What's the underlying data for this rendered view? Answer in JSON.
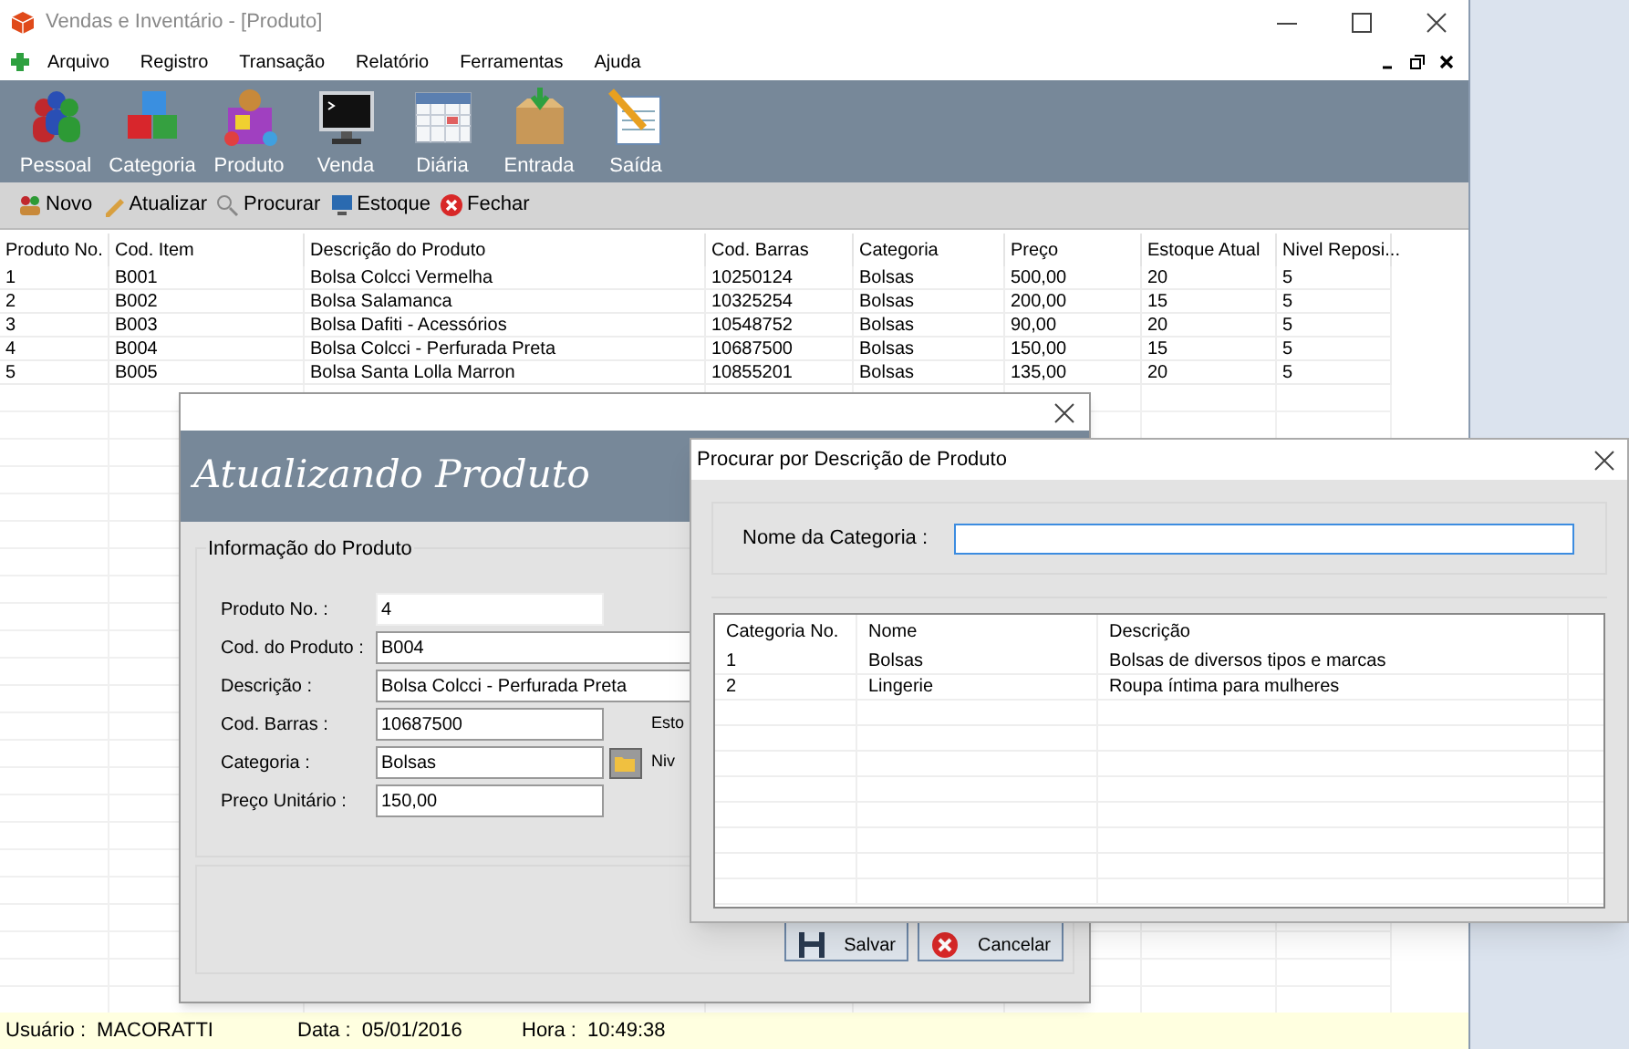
{
  "window": {
    "title": "Vendas e Inventário - [Produto]"
  },
  "menu": [
    "Arquivo",
    "Registro",
    "Transação",
    "Relatório",
    "Ferramentas",
    "Ajuda"
  ],
  "toolbar": [
    {
      "label": "Pessoal",
      "kind": "people"
    },
    {
      "label": "Categoria",
      "kind": "cubes"
    },
    {
      "label": "Produto",
      "kind": "toy"
    },
    {
      "label": "Venda",
      "kind": "monitor"
    },
    {
      "label": "Diária",
      "kind": "calendar"
    },
    {
      "label": "Entrada",
      "kind": "box"
    },
    {
      "label": "Saída",
      "kind": "notepad"
    }
  ],
  "actions": [
    {
      "label": "Novo",
      "kind": "new"
    },
    {
      "label": "Atualizar",
      "kind": "update"
    },
    {
      "label": "Procurar",
      "kind": "search"
    },
    {
      "label": "Estoque",
      "kind": "stock"
    },
    {
      "label": "Fechar",
      "kind": "close"
    }
  ],
  "table": {
    "columns": [
      "Produto No.",
      "Cod. Item",
      "Descrição do Produto",
      "Cod. Barras",
      "Categoria",
      "Preço",
      "Estoque Atual",
      "Nivel Reposi..."
    ],
    "rows": [
      [
        "1",
        "B001",
        "Bolsa Colcci Vermelha",
        "10250124",
        "Bolsas",
        "500,00",
        "20",
        "5"
      ],
      [
        "2",
        "B002",
        "Bolsa Salamanca",
        "10325254",
        "Bolsas",
        "200,00",
        "15",
        "5"
      ],
      [
        "3",
        "B003",
        "Bolsa Dafiti - Acessórios",
        "10548752",
        "Bolsas",
        "90,00",
        "20",
        "5"
      ],
      [
        "4",
        "B004",
        "Bolsa Colcci - Perfurada Preta",
        "10687500",
        "Bolsas",
        "150,00",
        "15",
        "5"
      ],
      [
        "5",
        "B005",
        "Bolsa Santa Lolla Marron",
        "10855201",
        "Bolsas",
        "135,00",
        "20",
        "5"
      ]
    ]
  },
  "edit_dialog": {
    "header": "Atualizando Produto",
    "group": "Informação do Produto",
    "fields": [
      {
        "label": "Produto No. :",
        "value": "4",
        "kind": "short"
      },
      {
        "label": "Cod. do Produto :",
        "value": "B004",
        "kind": "long"
      },
      {
        "label": "Descrição :",
        "value": "Bolsa Colcci - Perfurada Preta",
        "kind": "long"
      },
      {
        "label": "Cod. Barras :",
        "value": "10687500",
        "kind": "medium",
        "side_label": "Esto"
      },
      {
        "label": "Categoria :",
        "value": "Bolsas",
        "kind": "lookup",
        "side_label": "Niv"
      },
      {
        "label": "Preço Unitário :",
        "value": "150,00",
        "kind": "medium"
      }
    ],
    "buttons": [
      {
        "label": "Salvar",
        "kind": "save"
      },
      {
        "label": "Cancelar",
        "kind": "cancel"
      }
    ]
  },
  "search_dialog": {
    "title": "Procurar por Descrição de Produto",
    "field_label": "Nome da Categoria :",
    "table": {
      "columns": [
        "Categoria No.",
        "Nome",
        "Descrição"
      ],
      "rows": [
        [
          "1",
          "Bolsas",
          "Bolsas de diversos tipos e marcas"
        ],
        [
          "2",
          "Lingerie",
          "Roupa íntima para mulheres"
        ]
      ]
    }
  },
  "status_bar": [
    {
      "label": "Usuário :",
      "value": "MACORATTI"
    },
    {
      "label": "Data :",
      "value": "05/01/2016"
    },
    {
      "label": "Hora  :",
      "value": "10:49:38"
    }
  ]
}
